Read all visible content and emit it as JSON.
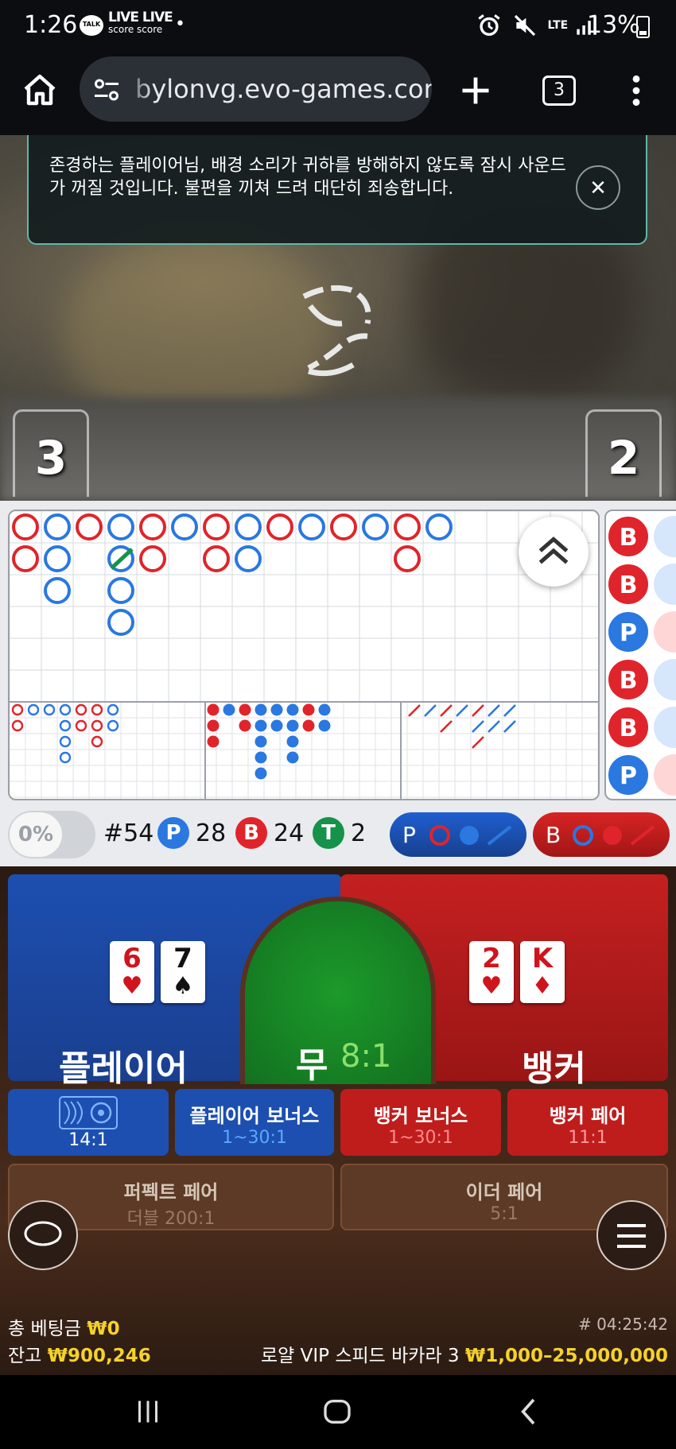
{
  "status_bar": {
    "time": "1:26",
    "talk_badge": "TALK",
    "live_label": "LIVE LIVE",
    "score_label": "score score",
    "dot": "•",
    "icons": [
      "alarm-icon",
      "mute-icon",
      "lte-icon",
      "signal-icon"
    ],
    "lte": "LTE",
    "battery": "13%"
  },
  "browser": {
    "url": "bylonvg.evo-games.com",
    "tab_count": "3"
  },
  "video": {
    "notice": "존경하는 플레이어님, 배경 소리가 귀하를 방해하지 않도록 잠시 사운드가 꺼질 것입니다. 불편을 끼쳐 드려 대단히 죄송합니다.",
    "close_symbol": "✕",
    "player_score": "3",
    "banker_score": "2"
  },
  "scoreboard": {
    "percent": "0%",
    "round_count": "#54",
    "player_letter": "P",
    "player_wins": "28",
    "banker_letter": "B",
    "banker_wins": "24",
    "tie_letter": "T",
    "ties": "2",
    "player_predict": "P",
    "banker_predict": "B",
    "bead_side": [
      "B",
      "B",
      "P",
      "B",
      "B",
      "P"
    ],
    "colors": {
      "player": "#2a78e0",
      "banker": "#e0242b",
      "tie": "#16924a"
    }
  },
  "bets": {
    "player_label": "플레이어",
    "tie_label": "무",
    "tie_odds": "8:1",
    "banker_label": "뱅커",
    "player_cards": [
      {
        "rank": "6",
        "suit": "♥"
      },
      {
        "rank": "7",
        "suit": "♠"
      }
    ],
    "banker_cards": [
      {
        "rank": "2",
        "suit": "♥"
      },
      {
        "rank": "K",
        "suit": "♦"
      }
    ],
    "side_bets": [
      {
        "name": "",
        "odds": "14:1"
      },
      {
        "name": "플레이어 보너스",
        "odds": "1~30:1"
      },
      {
        "name": "뱅커 보너스",
        "odds": "1~30:1"
      },
      {
        "name": "뱅커 페어",
        "odds": "11:1"
      }
    ],
    "perfect_pair": {
      "name": "퍼펙트 페어",
      "odds": "더블 200:1"
    },
    "either_pair": {
      "name": "이더 페어",
      "odds": "5:1"
    }
  },
  "footer": {
    "total_bet_label": "총 베팅금",
    "total_bet": "₩0",
    "balance_label": "잔고",
    "balance": "₩900,246",
    "round_id": "# 04:25:42",
    "table_name": "로얄 VIP 스피드 바카라 3",
    "limits": "₩1,000–25,000,000"
  }
}
